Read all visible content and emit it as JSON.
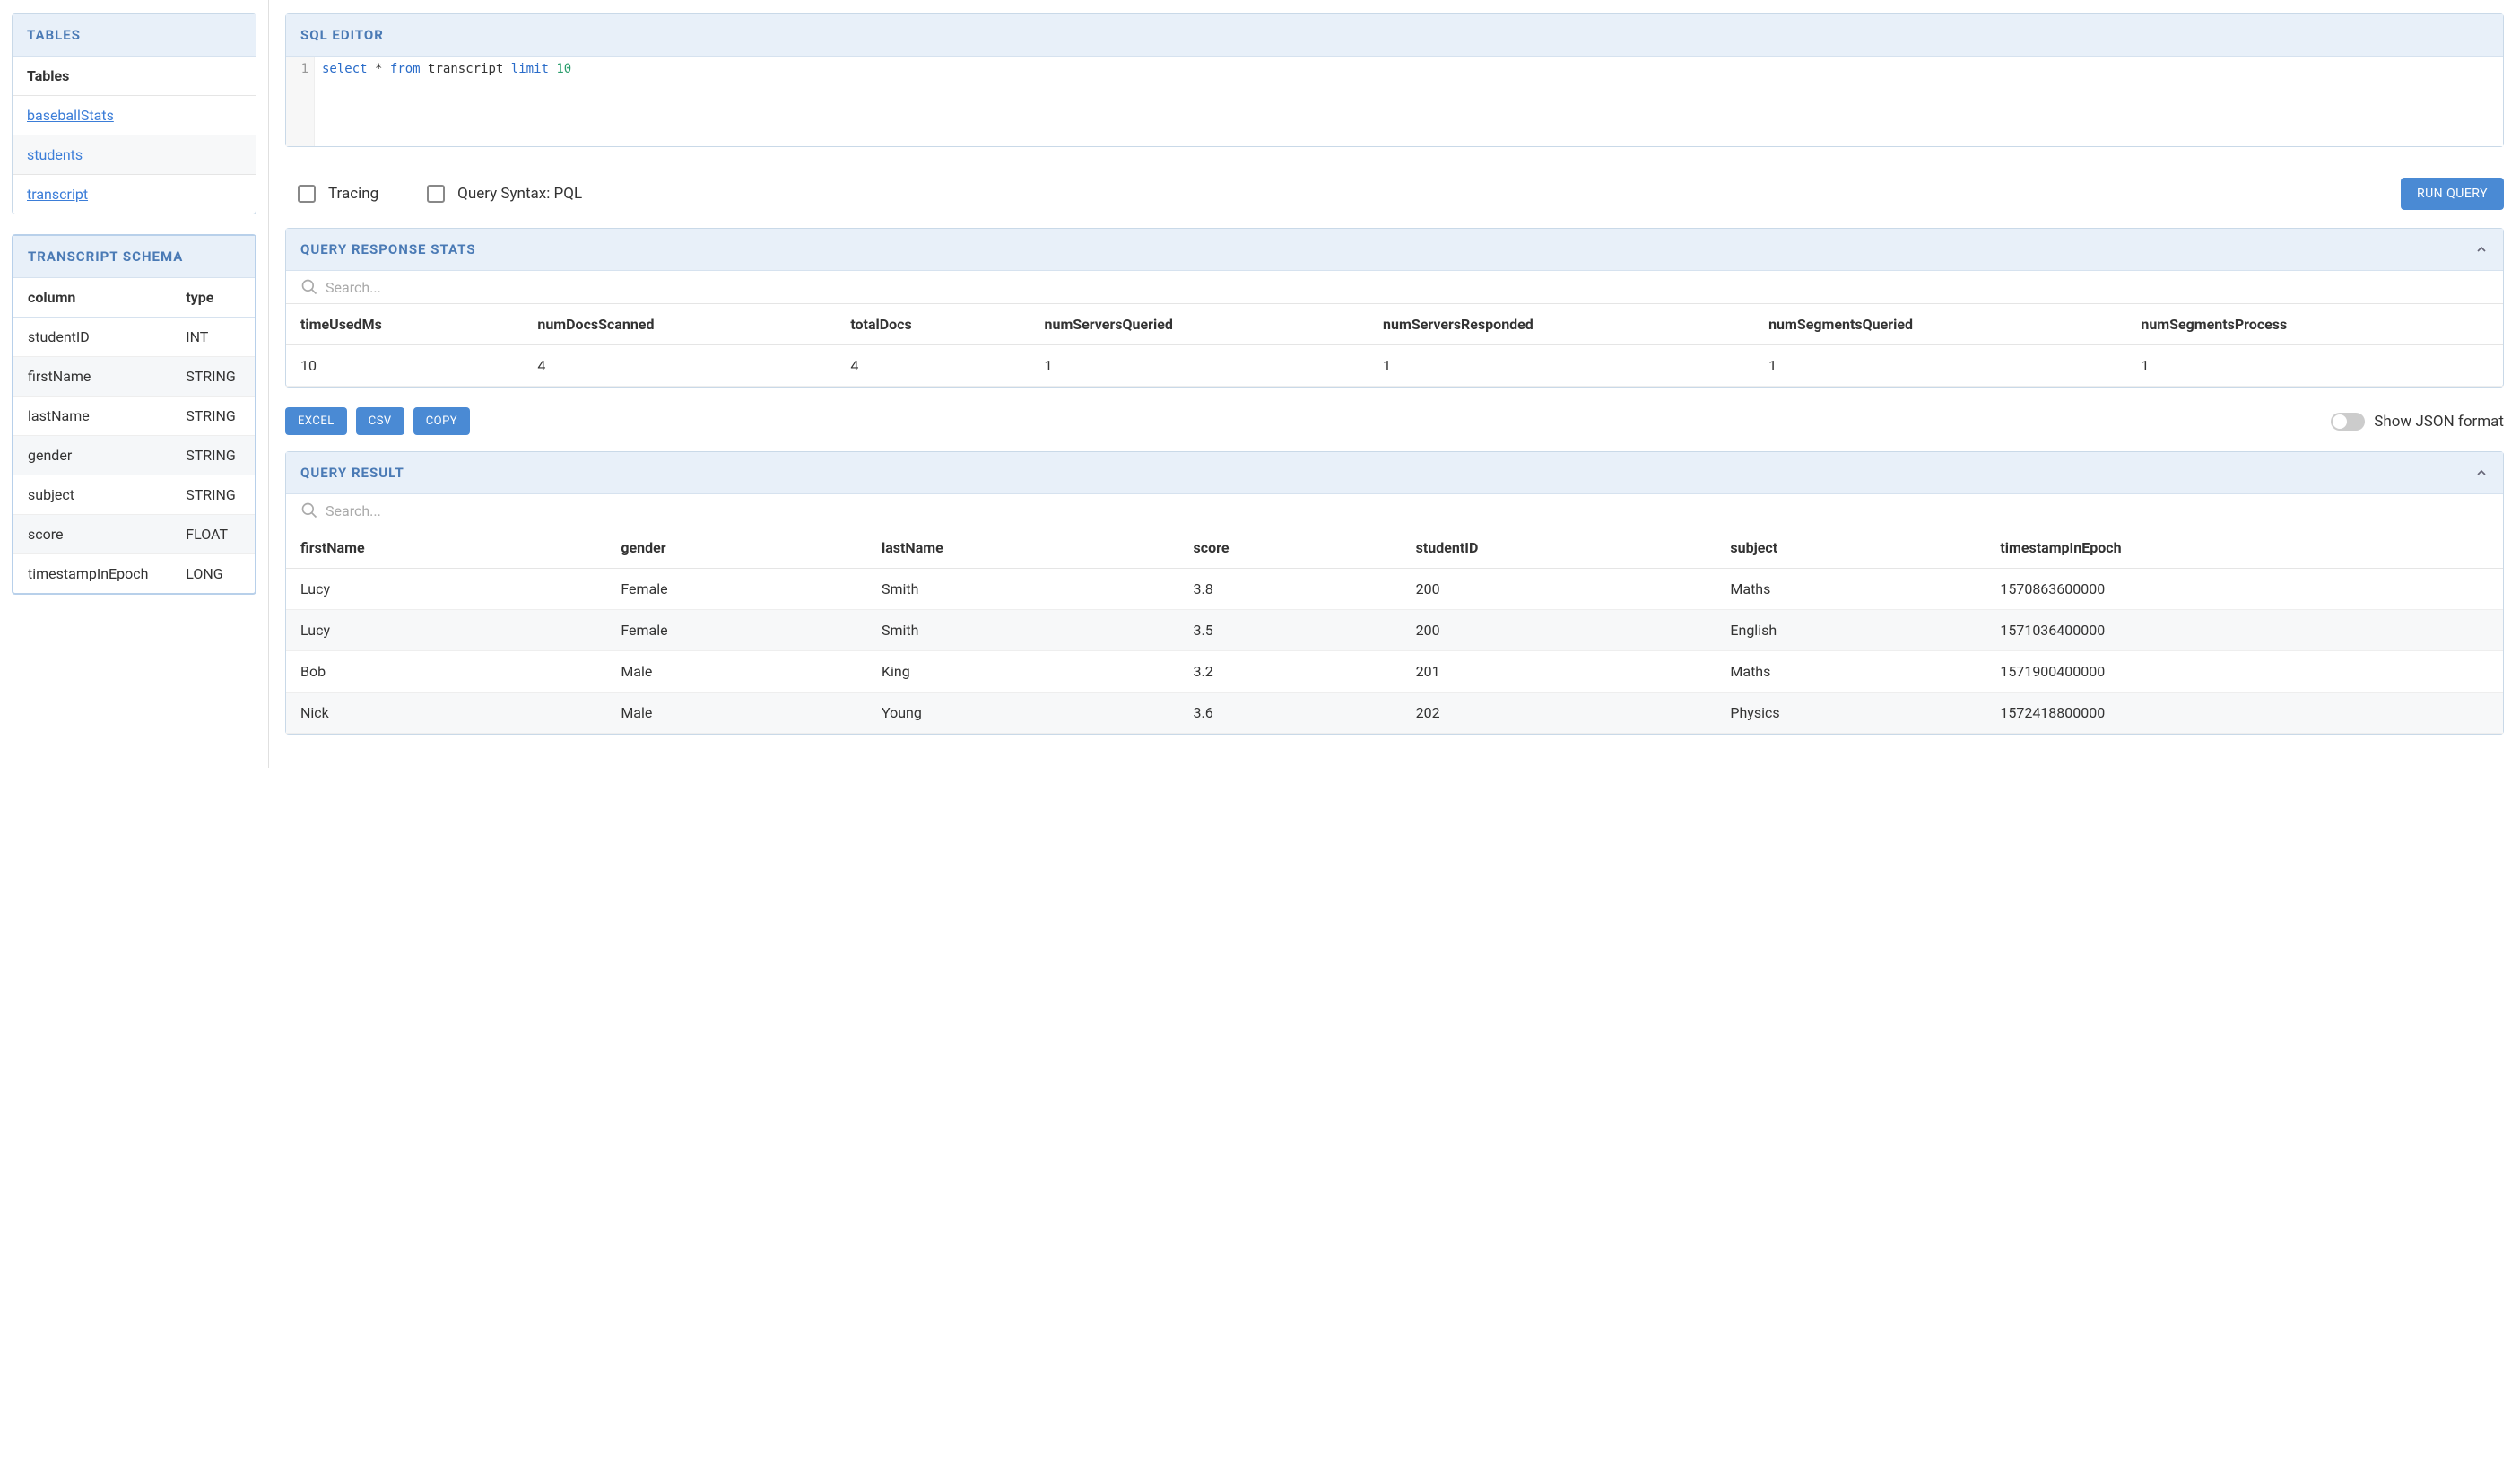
{
  "sidebar": {
    "tables_panel": {
      "title": "TABLES",
      "subheader": "Tables",
      "items": [
        "baseballStats",
        "students",
        "transcript"
      ]
    },
    "schema_panel": {
      "title": "TRANSCRIPT SCHEMA",
      "headers": {
        "col1": "column",
        "col2": "type"
      },
      "rows": [
        {
          "column": "studentID",
          "type": "INT"
        },
        {
          "column": "firstName",
          "type": "STRING"
        },
        {
          "column": "lastName",
          "type": "STRING"
        },
        {
          "column": "gender",
          "type": "STRING"
        },
        {
          "column": "subject",
          "type": "STRING"
        },
        {
          "column": "score",
          "type": "FLOAT"
        },
        {
          "column": "timestampInEpoch",
          "type": "LONG"
        }
      ]
    }
  },
  "editor": {
    "title": "SQL EDITOR",
    "line_no": "1",
    "code": {
      "kw1": "select",
      "star": "*",
      "kw2": "from",
      "ident": "transcript",
      "kw3": "limit",
      "num": "10"
    },
    "controls": {
      "tracing": "Tracing",
      "pql": "Query Syntax: PQL",
      "run": "RUN QUERY"
    }
  },
  "stats": {
    "title": "QUERY RESPONSE STATS",
    "search_placeholder": "Search...",
    "columns": [
      "timeUsedMs",
      "numDocsScanned",
      "totalDocs",
      "numServersQueried",
      "numServersResponded",
      "numSegmentsQueried",
      "numSegmentsProcess"
    ],
    "row": [
      "10",
      "4",
      "4",
      "1",
      "1",
      "1",
      "1"
    ]
  },
  "export": {
    "excel": "EXCEL",
    "csv": "CSV",
    "copy": "COPY",
    "json_toggle": "Show JSON format"
  },
  "result": {
    "title": "QUERY RESULT",
    "search_placeholder": "Search...",
    "columns": [
      "firstName",
      "gender",
      "lastName",
      "score",
      "studentID",
      "subject",
      "timestampInEpoch"
    ],
    "rows": [
      [
        "Lucy",
        "Female",
        "Smith",
        "3.8",
        "200",
        "Maths",
        "1570863600000"
      ],
      [
        "Lucy",
        "Female",
        "Smith",
        "3.5",
        "200",
        "English",
        "1571036400000"
      ],
      [
        "Bob",
        "Male",
        "King",
        "3.2",
        "201",
        "Maths",
        "1571900400000"
      ],
      [
        "Nick",
        "Male",
        "Young",
        "3.6",
        "202",
        "Physics",
        "1572418800000"
      ]
    ]
  }
}
